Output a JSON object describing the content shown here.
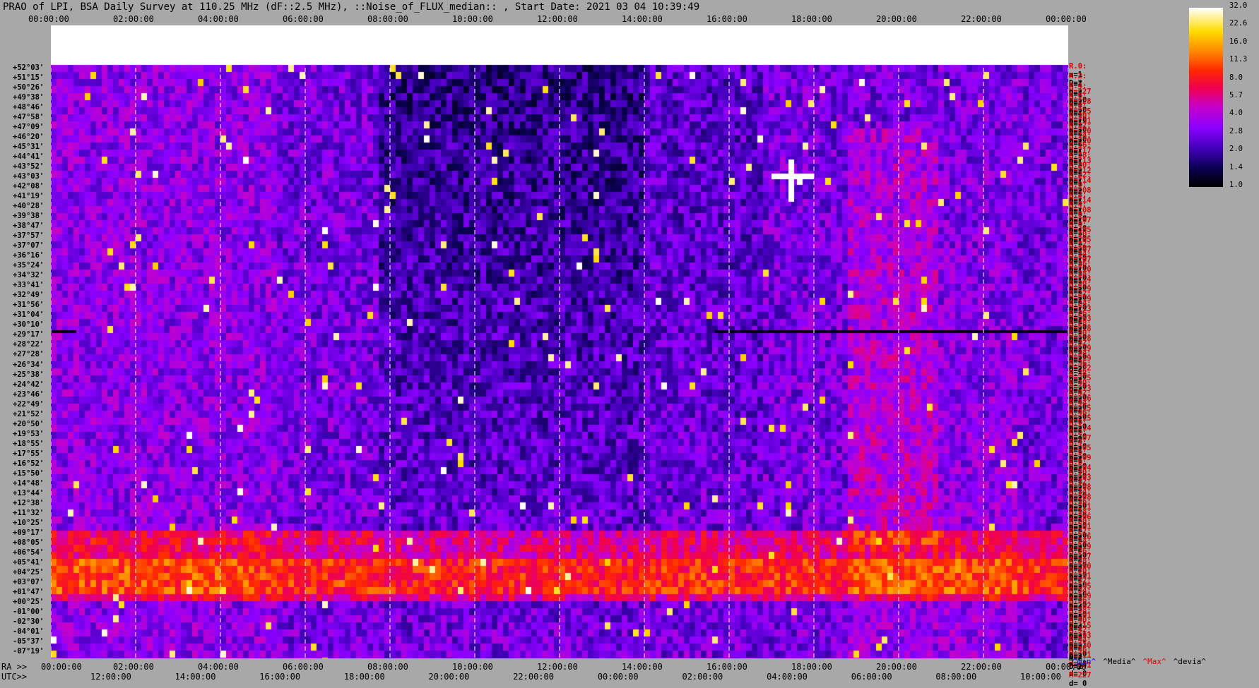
{
  "title": "PRAO of LPI, BSA Daily Survey at 110.25 MHz (dF::2.5 MHz), ::Noise_of_FLUX_median:: , Start Date: 2021 03 04 10:39:49",
  "axis_labels": {
    "ra": "RA >>",
    "utc": "UTC>>"
  },
  "colors": {
    "background": "#a8a8a8",
    "label_red": "#e00000"
  },
  "chart_data": {
    "type": "heatmap",
    "title": "PRAO of LPI, BSA Daily Survey at 110.25 MHz (dF::2.5 MHz), ::Noise_of_FLUX_median:: , Start Date: 2021 03 04 10:39:49",
    "top_ticks": [
      "00:00:00",
      "02:00:00",
      "04:00:00",
      "06:00:00",
      "08:00:00",
      "10:00:00",
      "12:00:00",
      "14:00:00",
      "16:00:00",
      "18:00:00",
      "20:00:00",
      "22:00:00",
      "00:00:00"
    ],
    "ra_ticks": [
      "00:00:00",
      "02:00:00",
      "04:00:00",
      "06:00:00",
      "08:00:00",
      "10:00:00",
      "12:00:00",
      "14:00:00",
      "16:00:00",
      "18:00:00",
      "20:00:00",
      "22:00:00",
      "00:00:00"
    ],
    "utc_ticks": [
      "12:00:00",
      "14:00:00",
      "16:00:00",
      "18:00:00",
      "20:00:00",
      "22:00:00",
      "00:00:00",
      "02:00:00",
      "04:00:00",
      "06:00:00",
      "08:00:00",
      "10:00:00"
    ],
    "dec_labels": [
      "+52°03'",
      "+51°15'",
      "+50°26'",
      "+49°38'",
      "+48°46'",
      "+47°58'",
      "+47°09'",
      "+46°20'",
      "+45°31'",
      "+44°41'",
      "+43°52'",
      "+43°03'",
      "+42°08'",
      "+41°19'",
      "+40°28'",
      "+39°38'",
      "+38°47'",
      "+37°57'",
      "+37°07'",
      "+36°16'",
      "+35°24'",
      "+34°32'",
      "+33°41'",
      "+32°49'",
      "+31°56'",
      "+31°04'",
      "+30°10'",
      "+29°17'",
      "+28°22'",
      "+27°28'",
      "+26°34'",
      "+25°38'",
      "+24°42'",
      "+23°46'",
      "+22°49'",
      "+21°52'",
      "+20°50'",
      "+19°53'",
      "+18°55'",
      "+17°55'",
      "+16°52'",
      "+15°50'",
      "+14°48'",
      "+13°44'",
      "+12°38'",
      "+11°32'",
      "+10°25'",
      "+09°17'",
      "+08°05'",
      "+06°54'",
      "+05°41'",
      "+04°25'",
      "+03°07'",
      "+01°47'",
      "+00°25'",
      "-01°00'",
      "-02°30'",
      "-04°01'",
      "-05°37'",
      "-07°19'"
    ],
    "colorbar": {
      "ticks": [
        "32.0",
        "22.6",
        "16.0",
        "11.3",
        "8.0",
        "5.7",
        "4.0",
        "2.8",
        "2.0",
        "1.4",
        "1.0"
      ],
      "range": [
        1.0,
        32.0
      ],
      "scale": "log",
      "colormap": "gnuplot-hot"
    },
    "row_stats": [
      [
        "R.0:",
        "m=1",
        "D=2",
        "M=227",
        "d= 0"
      ],
      [
        "R.2:",
        "m=1",
        "D=2",
        "M=228",
        "d= 0"
      ],
      [
        "R.4:",
        "m=1",
        "D=2",
        "M=225",
        "d= 0"
      ],
      [
        "R.6:",
        "m=1",
        "D=2",
        "M=231",
        "d= 0"
      ],
      [
        "R.8:",
        "m=1",
        "D=1",
        "M=220",
        "d= 0"
      ],
      [
        "R.10:",
        "m=1",
        "D=2",
        "M=220",
        "d="
      ],
      [
        "R.12:",
        "m=1",
        "D=2",
        "M=217",
        "d="
      ],
      [
        "R.14:",
        "m=1",
        "D=1",
        "M=213",
        "d="
      ],
      [
        "R.16:",
        "m=1",
        "D=1",
        "M=212",
        "d="
      ],
      [
        "R.18:",
        "m=1",
        "D=2",
        "M=214",
        "d="
      ],
      [
        "R.20:",
        "m=1",
        "D=1",
        "M=208",
        "d="
      ],
      [
        "R.22:",
        "m=1",
        "D=2",
        "M=214",
        "d="
      ],
      [
        "R.0:",
        "m=1",
        "D=1",
        "M=208",
        "d= 0"
      ],
      [
        "R.2:",
        "m=1",
        "D=1",
        "M=207",
        "d= 0"
      ],
      [
        "R.4:",
        "m=1",
        "D=1",
        "M=485",
        "d= 0"
      ],
      [
        "R.6:",
        "m=1",
        "D=1",
        "M=205",
        "d= 0"
      ],
      [
        "R.8:",
        "m=1",
        "D=1",
        "M=207",
        "d= 0"
      ],
      [
        "R.10:",
        "m=1",
        "D=2",
        "M=207",
        "d= 0"
      ],
      [
        "R.12:",
        "m=1",
        "D=1",
        "M=210",
        "d= 0"
      ],
      [
        "R.14:",
        "m=1",
        "D=1",
        "M=214",
        "d= 0"
      ],
      [
        "R.16:",
        "m=1",
        "D=1",
        "M=219",
        "d= 0"
      ],
      [
        "R.18:",
        "m=1",
        "D=2",
        "M=219",
        "d= 0"
      ],
      [
        "R.20:",
        "m=1",
        "D=2",
        "M=213",
        "d= 0"
      ],
      [
        "R.22:",
        "m=1",
        "D=1",
        "M=263",
        "d= 0"
      ],
      [
        "R.24:",
        "m=1",
        "D=2",
        "M=218",
        "d= 0"
      ],
      [
        "R.26:",
        "m=1",
        "D=2",
        "M=218",
        "d= 0"
      ],
      [
        "R.28:",
        "m=1",
        "D=2",
        "M=219",
        "d= 0"
      ],
      [
        "R.30:",
        "m=1",
        "D=2",
        "M=219",
        "d= 0"
      ],
      [
        "R.32:",
        "m=1",
        "D=2",
        "M=222",
        "d= 0"
      ],
      [
        "R.34:",
        "m=1",
        "D=2",
        "M=215",
        "d= 0"
      ],
      [
        "R.36:",
        "m=1",
        "D=2",
        "M=213",
        "d= 0"
      ],
      [
        "R.38:",
        "m=1",
        "D=2",
        "M=216",
        "d= 0"
      ],
      [
        "R.40:",
        "m=1",
        "D=2",
        "M=215",
        "d= 0"
      ],
      [
        "R.42:",
        "m=1",
        "D=2",
        "M=215",
        "d= 0"
      ],
      [
        "R.44:",
        "m=1",
        "D=2",
        "M=214",
        "d= 0"
      ],
      [
        "R.46:",
        "m=1",
        "D=2",
        "M=407",
        "d= 0"
      ],
      [
        "R.0:",
        "m=1",
        "D=2",
        "M=205",
        "d= 0"
      ],
      [
        "R.2:",
        "m=2",
        "D=2",
        "M=209",
        "d= 0"
      ],
      [
        "R.4:",
        "m=1",
        "D=2",
        "M=204",
        "d= 0"
      ],
      [
        "R.6:",
        "m=1",
        "D=2",
        "M=203",
        "d= 0"
      ],
      [
        "R.8:",
        "m=1",
        "D=2",
        "M=208",
        "d= 0"
      ],
      [
        "R.10:",
        "m=1",
        "D=2",
        "M=208",
        "d= 0"
      ],
      [
        "R.12:",
        "m=1",
        "D=2",
        "M=211",
        "d= 0"
      ],
      [
        "R.14:",
        "m=1",
        "D=2",
        "M=206",
        "d= 0"
      ],
      [
        "R.16:",
        "m=1",
        "D=2",
        "M=301",
        "d= 0"
      ],
      [
        "R.18:",
        "m=1",
        "D=2",
        "M=216",
        "d= 0"
      ],
      [
        "R.20:",
        "m=1",
        "D=2",
        "M=219",
        "d= 0"
      ],
      [
        "R.22:",
        "m=1",
        "D=2",
        "M=217",
        "d= 0"
      ],
      [
        "R.24:",
        "m=2",
        "D=3",
        "M=260",
        "d= 0"
      ],
      [
        "R.26:",
        "m=2",
        "D=3",
        "M=251",
        "d= 0"
      ],
      [
        "R.28:",
        "m=2",
        "D=3",
        "M=245",
        "d= 0"
      ],
      [
        "R.30:",
        "m=2",
        "D=3",
        "M=249",
        "d= 0"
      ],
      [
        "R.32:",
        "m=2",
        "D=3",
        "M=262",
        "d= 0"
      ],
      [
        "R.34:",
        "m=3",
        "D=4",
        "M=301",
        "d= 1"
      ],
      [
        "R.36:",
        "m=3",
        "D=5",
        "M=315",
        "d= 1"
      ],
      [
        "R.38:",
        "m=3",
        "D=4",
        "M=293",
        "d= 1"
      ],
      [
        "R.40:",
        "m=2",
        "D=3",
        "M=220",
        "d= 0"
      ],
      [
        "R.42:",
        "m=2",
        "D=2",
        "M=211",
        "d= 0"
      ],
      [
        "R.44:",
        "m=2",
        "D=2",
        "M=681",
        "d= 0"
      ],
      [
        "R.46:",
        "m=2",
        "D=2",
        "M=227",
        "d= 0"
      ]
    ],
    "legend": [
      {
        "label": "^min^",
        "color": "#0000ff"
      },
      {
        "label": "^Media^",
        "color": "#000000"
      },
      {
        "label": "^Max^",
        "color": "#e00000"
      },
      {
        "label": "^devia^",
        "color": "#000000"
      }
    ]
  }
}
